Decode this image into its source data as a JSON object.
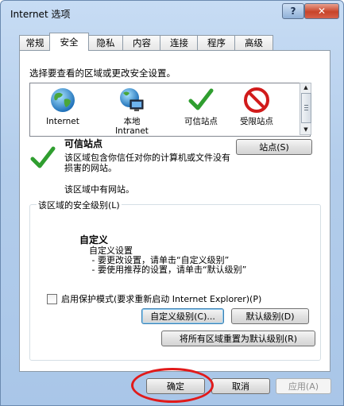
{
  "window": {
    "title": "Internet 选项",
    "help": "?",
    "close": "✕"
  },
  "tabs": [
    {
      "label": "常规",
      "active": false
    },
    {
      "label": "安全",
      "active": true
    },
    {
      "label": "隐私",
      "active": false
    },
    {
      "label": "内容",
      "active": false
    },
    {
      "label": "连接",
      "active": false
    },
    {
      "label": "程序",
      "active": false
    },
    {
      "label": "高级",
      "active": false
    }
  ],
  "security": {
    "prompt": "选择要查看的区域或更改安全设置。",
    "zones": [
      {
        "label": "Internet",
        "icon": "globe-icon"
      },
      {
        "label": "本地\nIntranet",
        "icon": "intranet-icon"
      },
      {
        "label": "可信站点",
        "icon": "check-icon"
      },
      {
        "label": "受限站点",
        "icon": "restricted-icon"
      }
    ],
    "selected_zone": {
      "title": "可信站点",
      "description": "该区域包含你信任对你的计算机或文件没有损害的网站。",
      "note": "该区域中有网站。",
      "sites_button": "站点(S)"
    },
    "level": {
      "group_label": "该区域的安全级别(L)",
      "title": "自定义",
      "description": "自定义设置\n - 要更改设置，请单击“自定义级别”\n - 要使用推荐的设置，请单击“默认级别”"
    },
    "protected_mode": {
      "label": "启用保护模式(要求重新启动 Internet Explorer)(P)",
      "checked": false
    },
    "custom_level_button": "自定义级别(C)...",
    "default_level_button": "默认级别(D)",
    "reset_all_button": "将所有区域重置为默认级别(R)"
  },
  "footer": {
    "ok": "确定",
    "cancel": "取消",
    "apply": "应用(A)"
  },
  "colors": {
    "annotation": "#e11a1a",
    "accent": "#3c7fb1"
  }
}
